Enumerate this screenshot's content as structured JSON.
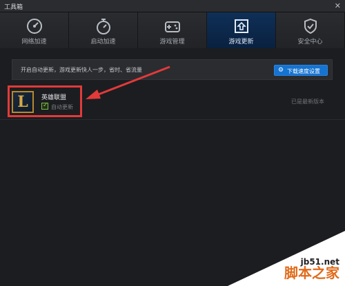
{
  "window": {
    "title": "工具箱",
    "close_glyph": "✕"
  },
  "tabs": [
    {
      "label": "网络加速",
      "icon": "gauge-icon",
      "active": false
    },
    {
      "label": "启动加速",
      "icon": "stopwatch-icon",
      "active": false
    },
    {
      "label": "游戏管理",
      "icon": "gamepad-icon",
      "active": false
    },
    {
      "label": "游戏更新",
      "icon": "update-arrow-icon",
      "active": true
    },
    {
      "label": "安全中心",
      "icon": "shield-check-icon",
      "active": false
    }
  ],
  "notice": {
    "text": "开启自动更新，游戏更新快人一步，省时、省流量",
    "button_label": "下载速度设置",
    "button_icon": "gear-icon"
  },
  "games": [
    {
      "name": "英雄联盟",
      "logo_letter": "L",
      "auto_update_label": "自动更新",
      "auto_update_checked": true,
      "status": "已是最新版本"
    }
  ],
  "watermark": {
    "site": "jb51.net",
    "brand": "脚本之家"
  },
  "colors": {
    "accent": "#1573d1",
    "highlight": "#e23a3a",
    "active_tab": "#0f2f57"
  }
}
